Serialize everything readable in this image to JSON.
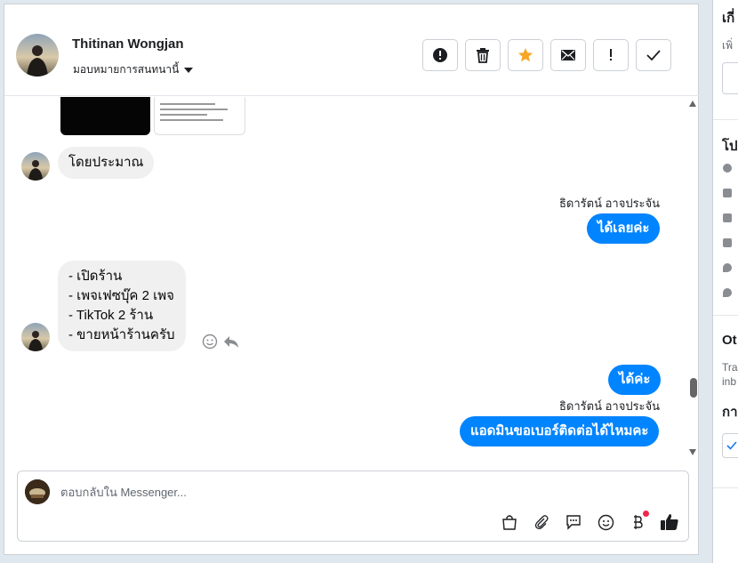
{
  "header": {
    "contact_name": "Thitinan Wongjan",
    "assign_label": "มอบหมายการสนทนานี้"
  },
  "toolbar": [
    {
      "icon": "alert-circle-icon"
    },
    {
      "icon": "trash-icon"
    },
    {
      "icon": "star-icon",
      "color": "#f5a623"
    },
    {
      "icon": "envelope-icon"
    },
    {
      "icon": "exclamation-icon"
    },
    {
      "icon": "check-icon"
    }
  ],
  "messages": [
    {
      "from": "customer",
      "text": "โดยประมาณ"
    },
    {
      "from": "page",
      "sender": "ธิดารัตน์ อาจประจัน",
      "text": "ได้เลยค่ะ"
    },
    {
      "from": "customer",
      "lines": [
        "- เปิดร้าน",
        "- เพจเฟซบุ๊ค 2 เพจ",
        "- TikTok 2 ร้าน",
        "- ขายหน้าร้านครับ"
      ]
    },
    {
      "from": "page",
      "text": "ได้ค่ะ"
    },
    {
      "from": "page",
      "sender": "ธิดารัตน์ อาจประจัน",
      "text": "แอดมินขอเบอร์ติดต่อได้ไหมคะ"
    }
  ],
  "composer": {
    "placeholder": "ตอบกลับใน Messenger...",
    "tools": [
      "shopping-bag-icon",
      "paperclip-icon",
      "saved-replies-icon",
      "emoji-icon",
      "baht-payment-icon",
      "thumbs-up-icon"
    ]
  },
  "right_panel": {
    "heading1": "เกี่",
    "sub1": "เพิ่",
    "heading2": "โป",
    "heading3": "Ot",
    "small1": "Tra",
    "small2": "inb",
    "heading4": "กา"
  },
  "colors": {
    "accent": "#0084ff",
    "star": "#f5a623",
    "notification": "#f02849"
  }
}
